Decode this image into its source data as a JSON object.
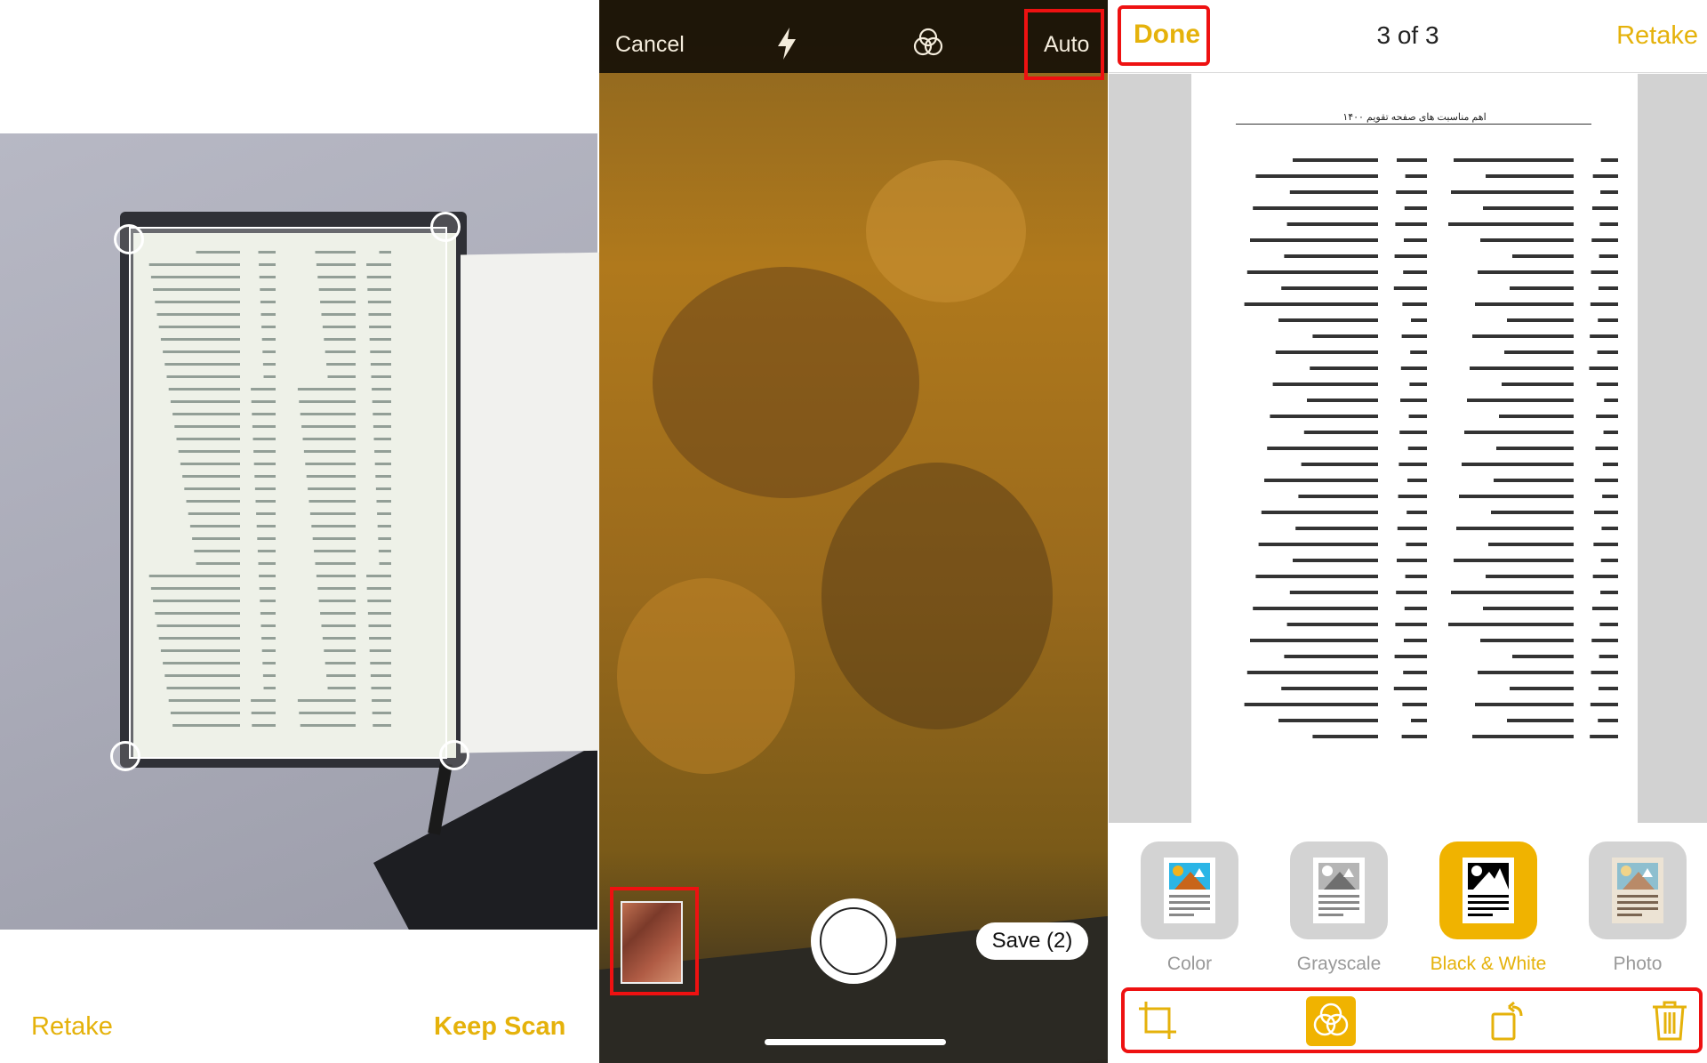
{
  "colors": {
    "accent": "#e5b20b",
    "highlight_box": "#e11111"
  },
  "review_screen": {
    "retake_label": "Retake",
    "keep_scan_label": "Keep Scan"
  },
  "camera_screen": {
    "cancel_label": "Cancel",
    "flash_icon": "flash-icon",
    "filter_icon": "filter-icon",
    "mode_label": "Auto",
    "save_label": "Save (2)"
  },
  "edit_screen": {
    "done_label": "Done",
    "page_counter": "3 of 3",
    "retake_label": "Retake",
    "document_title": "اهم مناسبت های صفحه تقویم ۱۴۰۰",
    "filters": [
      {
        "label": "Color"
      },
      {
        "label": "Grayscale"
      },
      {
        "label": "Black & White",
        "selected": true
      },
      {
        "label": "Photo"
      }
    ],
    "toolbar": [
      "crop-icon",
      "filter-icon",
      "rotate-icon",
      "trash-icon"
    ]
  }
}
